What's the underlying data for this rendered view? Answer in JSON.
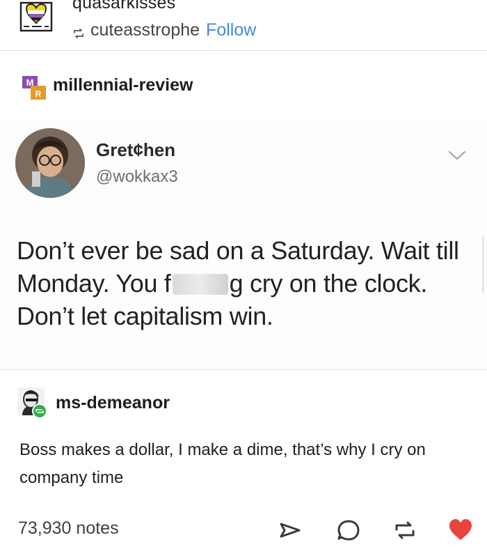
{
  "header": {
    "username": "quasarkisses",
    "reblogged_from": "cuteasstrophe",
    "follow_label": "Follow"
  },
  "reblog_source": {
    "username": "millennial-review",
    "badge_letters": [
      "M",
      "R"
    ]
  },
  "tweet": {
    "display_name": "Gret¢hen",
    "handle": "@wokkax3",
    "text_part1": "Don’t ever be sad on a Saturday. Wait till Monday. You f",
    "text_part2": "g cry on the clock. Don’t let capitalism win."
  },
  "comment": {
    "username": "ms-demeanor",
    "text": "Boss makes a dollar, I make a dime, that’s why I cry on company time"
  },
  "footer": {
    "notes": "73,930 notes"
  },
  "colors": {
    "follow": "#3d8be3",
    "like": "#e8453c",
    "reblog_badge": "#27b34a"
  },
  "icons": [
    "reblog-icon",
    "chevron-down-icon",
    "share-icon",
    "reply-icon",
    "reblog-icon",
    "heart-icon"
  ]
}
